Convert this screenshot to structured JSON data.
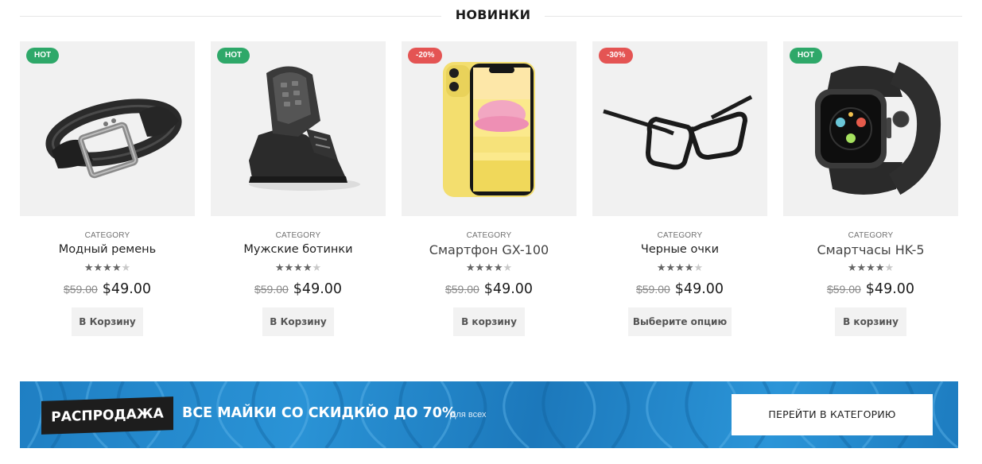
{
  "section": {
    "title": "НОВИНКИ"
  },
  "products": [
    {
      "badge": "HOT",
      "category": "CATEGORY",
      "title": "Модный ремень",
      "rating": 4,
      "rating_max": 5,
      "old_price": "$59.00",
      "price": "$49.00",
      "button": "В Корзину"
    },
    {
      "badge": "HOT",
      "category": "CATEGORY",
      "title": "Мужские ботинки",
      "rating": 4,
      "rating_max": 5,
      "old_price": "$59.00",
      "price": "$49.00",
      "button": "В Корзину"
    },
    {
      "badge": "-20%",
      "category": "CATEGORY",
      "title": "Смартфон GX-100",
      "rating": 4,
      "rating_max": 5,
      "old_price": "$59.00",
      "price": "$49.00",
      "button": "В корзину"
    },
    {
      "badge": "-30%",
      "category": "CATEGORY",
      "title": "Черные очки",
      "rating": 4,
      "rating_max": 5,
      "old_price": "$59.00",
      "price": "$49.00",
      "button": "Выберите опцию"
    },
    {
      "badge": "HOT",
      "category": "CATEGORY",
      "title": "Смартчасы HK-5",
      "rating": 4,
      "rating_max": 5,
      "old_price": "$59.00",
      "price": "$49.00",
      "button": "В корзину"
    }
  ],
  "banner": {
    "tag": "РАСПРОДАЖА",
    "headline": "ВСЕ МАЙКИ СО СКИДКЙО ДО 70%",
    "sub": "Для всех",
    "cta": "ПЕРЕЙТИ В КАТЕГОРИЮ"
  },
  "colors": {
    "hot_badge": "#2ea869",
    "sale_badge": "#e45453",
    "banner": "#2a8ccd"
  },
  "icons": [
    "belt-image",
    "boots-image",
    "phone-image",
    "glasses-image",
    "watch-image",
    "star-icon"
  ]
}
